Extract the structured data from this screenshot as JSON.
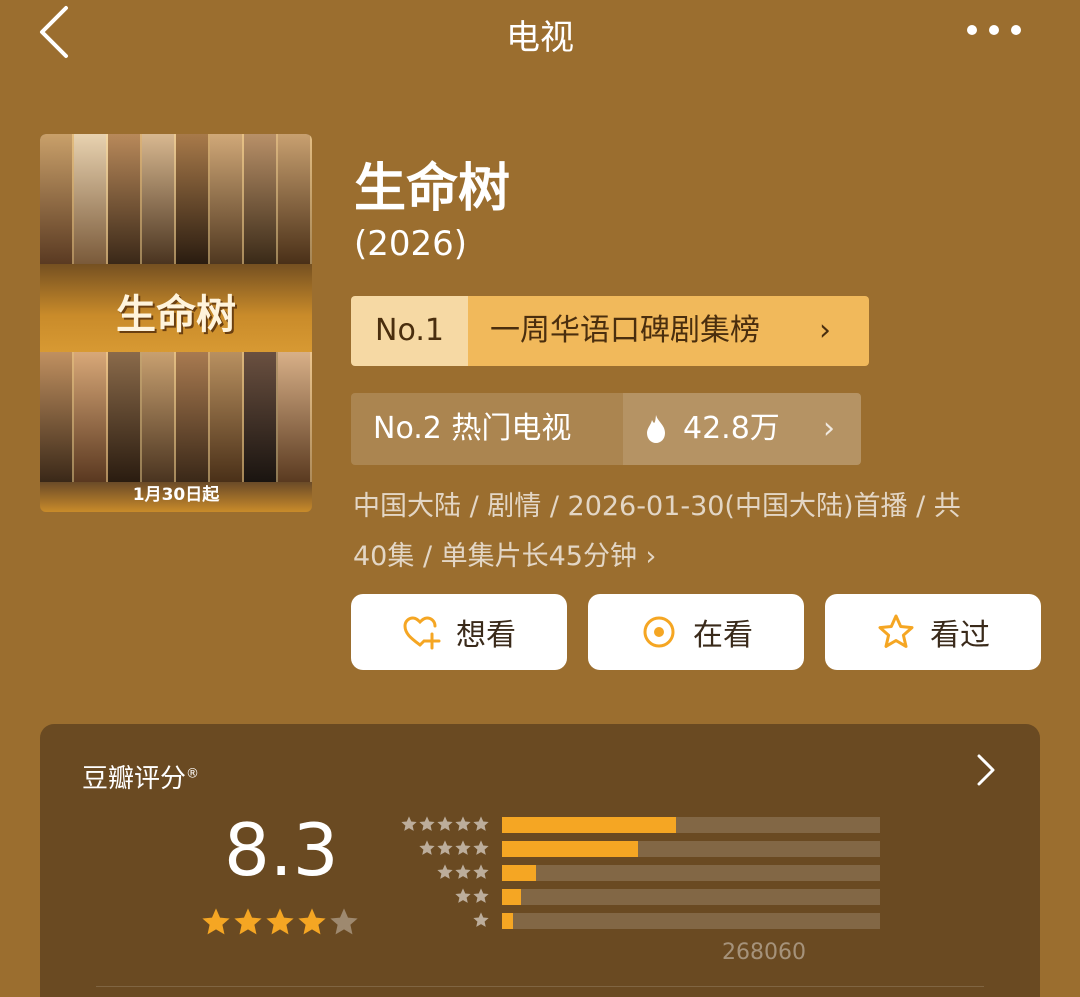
{
  "nav": {
    "title": "电视"
  },
  "poster": {
    "title_text": "生命树",
    "date_text": "1月30日起"
  },
  "show": {
    "title": "生命树",
    "year": "(2026)"
  },
  "rank1": {
    "number": "No.1",
    "label": "一周华语口碑剧集榜",
    "chevron": "›"
  },
  "rank2": {
    "number": "No.2 热门电视",
    "heat": "42.8万",
    "chevron": "›"
  },
  "meta": {
    "line1": "中国大陆 / 剧情 / 2026-01-30(中国大陆)首播 / 共",
    "line2": "40集 / 单集片长45分钟 ›"
  },
  "actions": [
    {
      "label": "想看",
      "icon": "heart-plus-icon"
    },
    {
      "label": "在看",
      "icon": "target-icon"
    },
    {
      "label": "看过",
      "icon": "star-outline-icon"
    }
  ],
  "rating": {
    "label": "豆瓣评分",
    "trademark": "®",
    "score": "8.3",
    "stars_filled": 4,
    "stars_total": 5,
    "count": "268060",
    "distribution": [
      {
        "stars": 5,
        "fraction": 0.46
      },
      {
        "stars": 4,
        "fraction": 0.36
      },
      {
        "stars": 3,
        "fraction": 0.09
      },
      {
        "stars": 2,
        "fraction": 0.05
      },
      {
        "stars": 1,
        "fraction": 0.03
      }
    ]
  },
  "colors": {
    "background": "#9b6e2f",
    "accent": "#f5a623",
    "card": "#6a4a22"
  }
}
